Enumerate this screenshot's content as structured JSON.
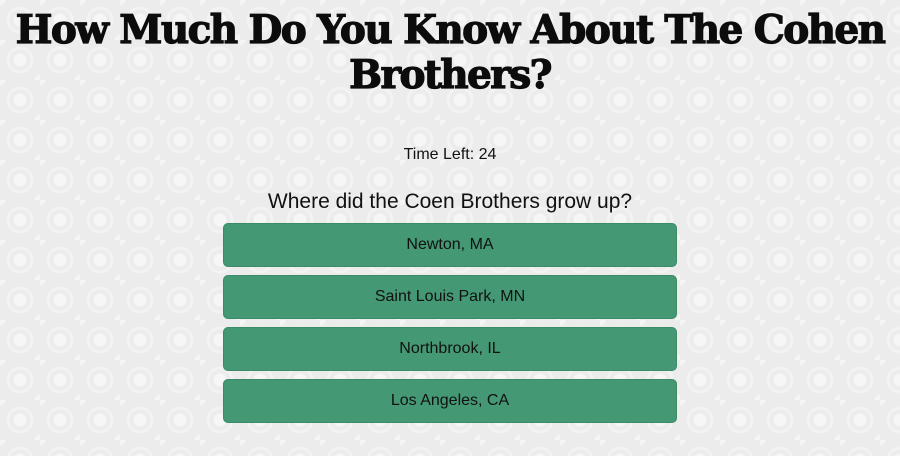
{
  "title": "How Much Do You Know About The Cohen Brothers?",
  "timer": {
    "label": "Time Left: 24"
  },
  "question": {
    "text": "Where did the Coen Brothers grow up?"
  },
  "answers": [
    {
      "label": "Newton, MA"
    },
    {
      "label": "Saint Louis Park, MN"
    },
    {
      "label": "Northbrook, IL"
    },
    {
      "label": "Los Angeles, CA"
    }
  ],
  "colors": {
    "answer_button": "#449874",
    "background": "#ececec",
    "text": "#111111"
  }
}
